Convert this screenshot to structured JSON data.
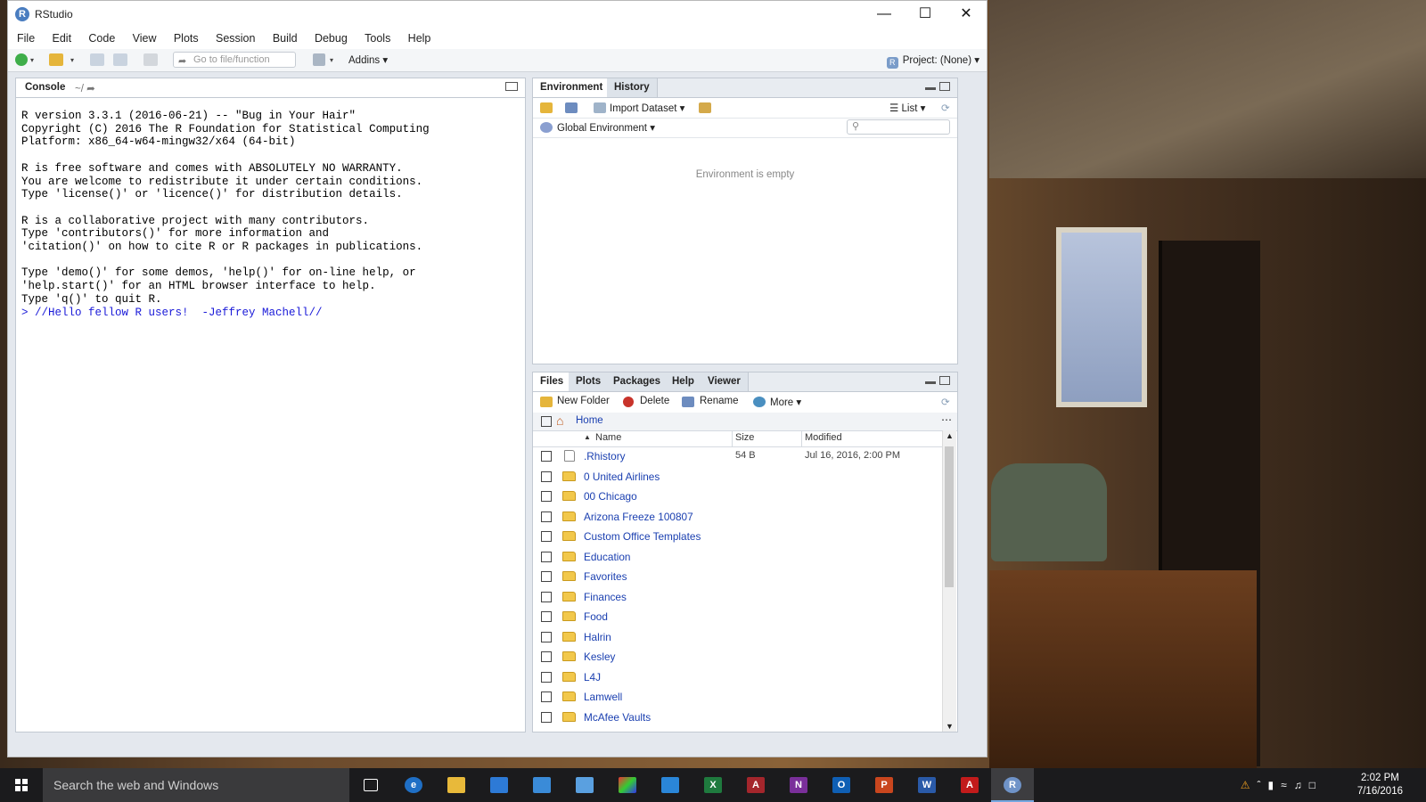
{
  "window": {
    "title": "RStudio"
  },
  "menu": [
    "File",
    "Edit",
    "Code",
    "View",
    "Plots",
    "Session",
    "Build",
    "Debug",
    "Tools",
    "Help"
  ],
  "toolbar": {
    "goto_placeholder": "Go to file/function",
    "addins_label": "Addins",
    "project_label": "Project: (None)"
  },
  "console": {
    "tab_label": "Console",
    "path": "~/",
    "output": "R version 3.3.1 (2016-06-21) -- \"Bug in Your Hair\"\nCopyright (C) 2016 The R Foundation for Statistical Computing\nPlatform: x86_64-w64-mingw32/x64 (64-bit)\n\nR is free software and comes with ABSOLUTELY NO WARRANTY.\nYou are welcome to redistribute it under certain conditions.\nType 'license()' or 'licence()' for distribution details.\n\nR is a collaborative project with many contributors.\nType 'contributors()' for more information and\n'citation()' on how to cite R or R packages in publications.\n\nType 'demo()' for some demos, 'help()' for on-line help, or\n'help.start()' for an HTML browser interface to help.\nType 'q()' to quit R.\n",
    "command": "> //Hello fellow R users!  -Jeffrey Machell//"
  },
  "environment": {
    "tabs": [
      "Environment",
      "History"
    ],
    "import_label": "Import Dataset",
    "list_label": "List",
    "scope_label": "Global Environment",
    "empty_text": "Environment is empty"
  },
  "files": {
    "tabs": [
      "Files",
      "Plots",
      "Packages",
      "Help",
      "Viewer"
    ],
    "new_folder_label": "New Folder",
    "delete_label": "Delete",
    "rename_label": "Rename",
    "more_label": "More",
    "path_label": "Home",
    "columns": {
      "name": "Name",
      "size": "Size",
      "modified": "Modified"
    },
    "rows": [
      {
        "name": ".Rhistory",
        "size": "54 B",
        "modified": "Jul 16, 2016, 2:00 PM",
        "type": "file"
      },
      {
        "name": "0 United Airlines",
        "size": "",
        "modified": "",
        "type": "folder"
      },
      {
        "name": "00 Chicago",
        "size": "",
        "modified": "",
        "type": "folder"
      },
      {
        "name": "Arizona Freeze 100807",
        "size": "",
        "modified": "",
        "type": "folder"
      },
      {
        "name": "Custom Office Templates",
        "size": "",
        "modified": "",
        "type": "folder"
      },
      {
        "name": "Education",
        "size": "",
        "modified": "",
        "type": "folder"
      },
      {
        "name": "Favorites",
        "size": "",
        "modified": "",
        "type": "folder"
      },
      {
        "name": "Finances",
        "size": "",
        "modified": "",
        "type": "folder"
      },
      {
        "name": "Food",
        "size": "",
        "modified": "",
        "type": "folder"
      },
      {
        "name": "Halrin",
        "size": "",
        "modified": "",
        "type": "folder"
      },
      {
        "name": "Kesley",
        "size": "",
        "modified": "",
        "type": "folder"
      },
      {
        "name": "L4J",
        "size": "",
        "modified": "",
        "type": "folder"
      },
      {
        "name": "Lamwell",
        "size": "",
        "modified": "",
        "type": "folder"
      },
      {
        "name": "McAfee Vaults",
        "size": "",
        "modified": "",
        "type": "folder"
      }
    ]
  },
  "taskbar": {
    "search_placeholder": "Search the web and Windows",
    "time": "2:02 PM",
    "date": "7/16/2016"
  },
  "colors": {
    "link_blue": "#1a3fb0",
    "console_command": "#1a1ad8",
    "taskbar_bg": "#1b1b1d"
  }
}
